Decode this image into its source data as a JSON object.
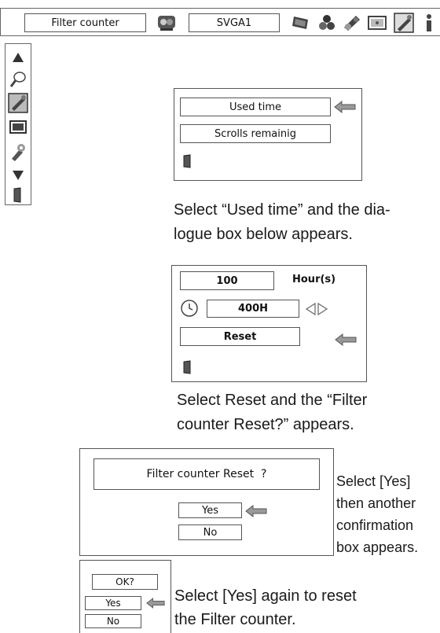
{
  "menubar": {
    "title": "Filter counter",
    "mode": "SVGA1",
    "icons": [
      "pc-adjust-icon",
      "display-icon",
      "color-icon",
      "image-icon",
      "wrench-icon",
      "info-icon"
    ]
  },
  "sidebar": {
    "items": [
      "up-arrow-icon",
      "lamp-icon",
      "filter-icon",
      "screen-icon",
      "settings-icon",
      "down-arrow-icon",
      "exit-icon"
    ]
  },
  "submenu1": {
    "item1": "Used time",
    "item2": "Scrolls remainig"
  },
  "caption1": {
    "line1": "Select “Used time” and the dia-",
    "line2": "logue box below appears."
  },
  "hours_dialog": {
    "used_value": "100",
    "unit": "Hour(s)",
    "limit_value": "400H",
    "reset_label": "Reset"
  },
  "caption2": {
    "line1": "Select Reset and the “Filter",
    "line2": "counter Reset?” appears."
  },
  "confirm_dialog": {
    "question": "Filter counter Reset  ?",
    "yes": "Yes",
    "no": "No"
  },
  "caption3": {
    "line1": "Select [Yes]",
    "line2": "then another",
    "line3": "confirmation",
    "line4": "box appears."
  },
  "ok_dialog": {
    "question": "OK?",
    "yes": "Yes",
    "no": "No"
  },
  "caption4": {
    "line1": "Select [Yes] again to reset",
    "line2": "the Filter counter."
  }
}
